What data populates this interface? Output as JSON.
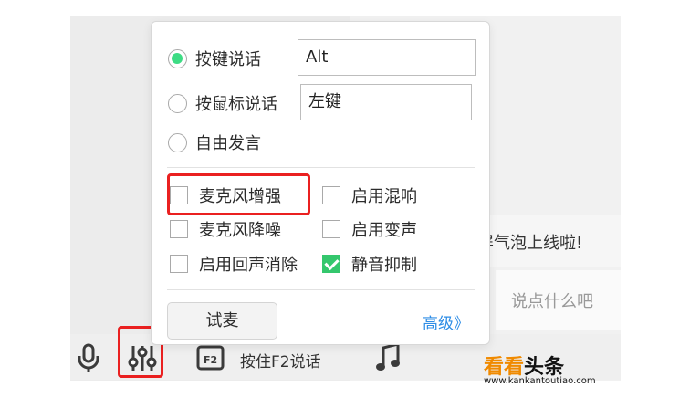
{
  "background": {
    "topic_text": "公屏气泡上线啦!",
    "chat_placeholder": "说点什么吧"
  },
  "voice_popup": {
    "modes": [
      {
        "label": "按键说话",
        "selected": true,
        "value": "Alt"
      },
      {
        "label": "按鼠标说话",
        "selected": false,
        "value": "左键"
      },
      {
        "label": "自由发言",
        "selected": false
      }
    ],
    "options_left": [
      {
        "label": "麦克风增强",
        "checked": false
      },
      {
        "label": "麦克风降噪",
        "checked": false
      },
      {
        "label": "启用回声消除",
        "checked": false
      }
    ],
    "options_right": [
      {
        "label": "启用混响",
        "checked": false
      },
      {
        "label": "启用变声",
        "checked": false
      },
      {
        "label": "静音抑制",
        "checked": true
      }
    ],
    "try_button": "试麦",
    "advanced_link": "高级》"
  },
  "toolbar": {
    "push_to_talk_label": "按住F2说话",
    "f2_key": "F2",
    "icons": [
      "mic-icon",
      "voice-settings-icon",
      "f2-key-icon",
      "music-icon"
    ]
  },
  "watermark": {
    "brand_a": "看看",
    "brand_b": "头条",
    "url": "www.kankantoutiao.com"
  },
  "colors": {
    "highlight_red": "#ea2020",
    "radio_green": "#3ddc84",
    "check_green": "#34c76d",
    "link_blue": "#2e8de6"
  }
}
